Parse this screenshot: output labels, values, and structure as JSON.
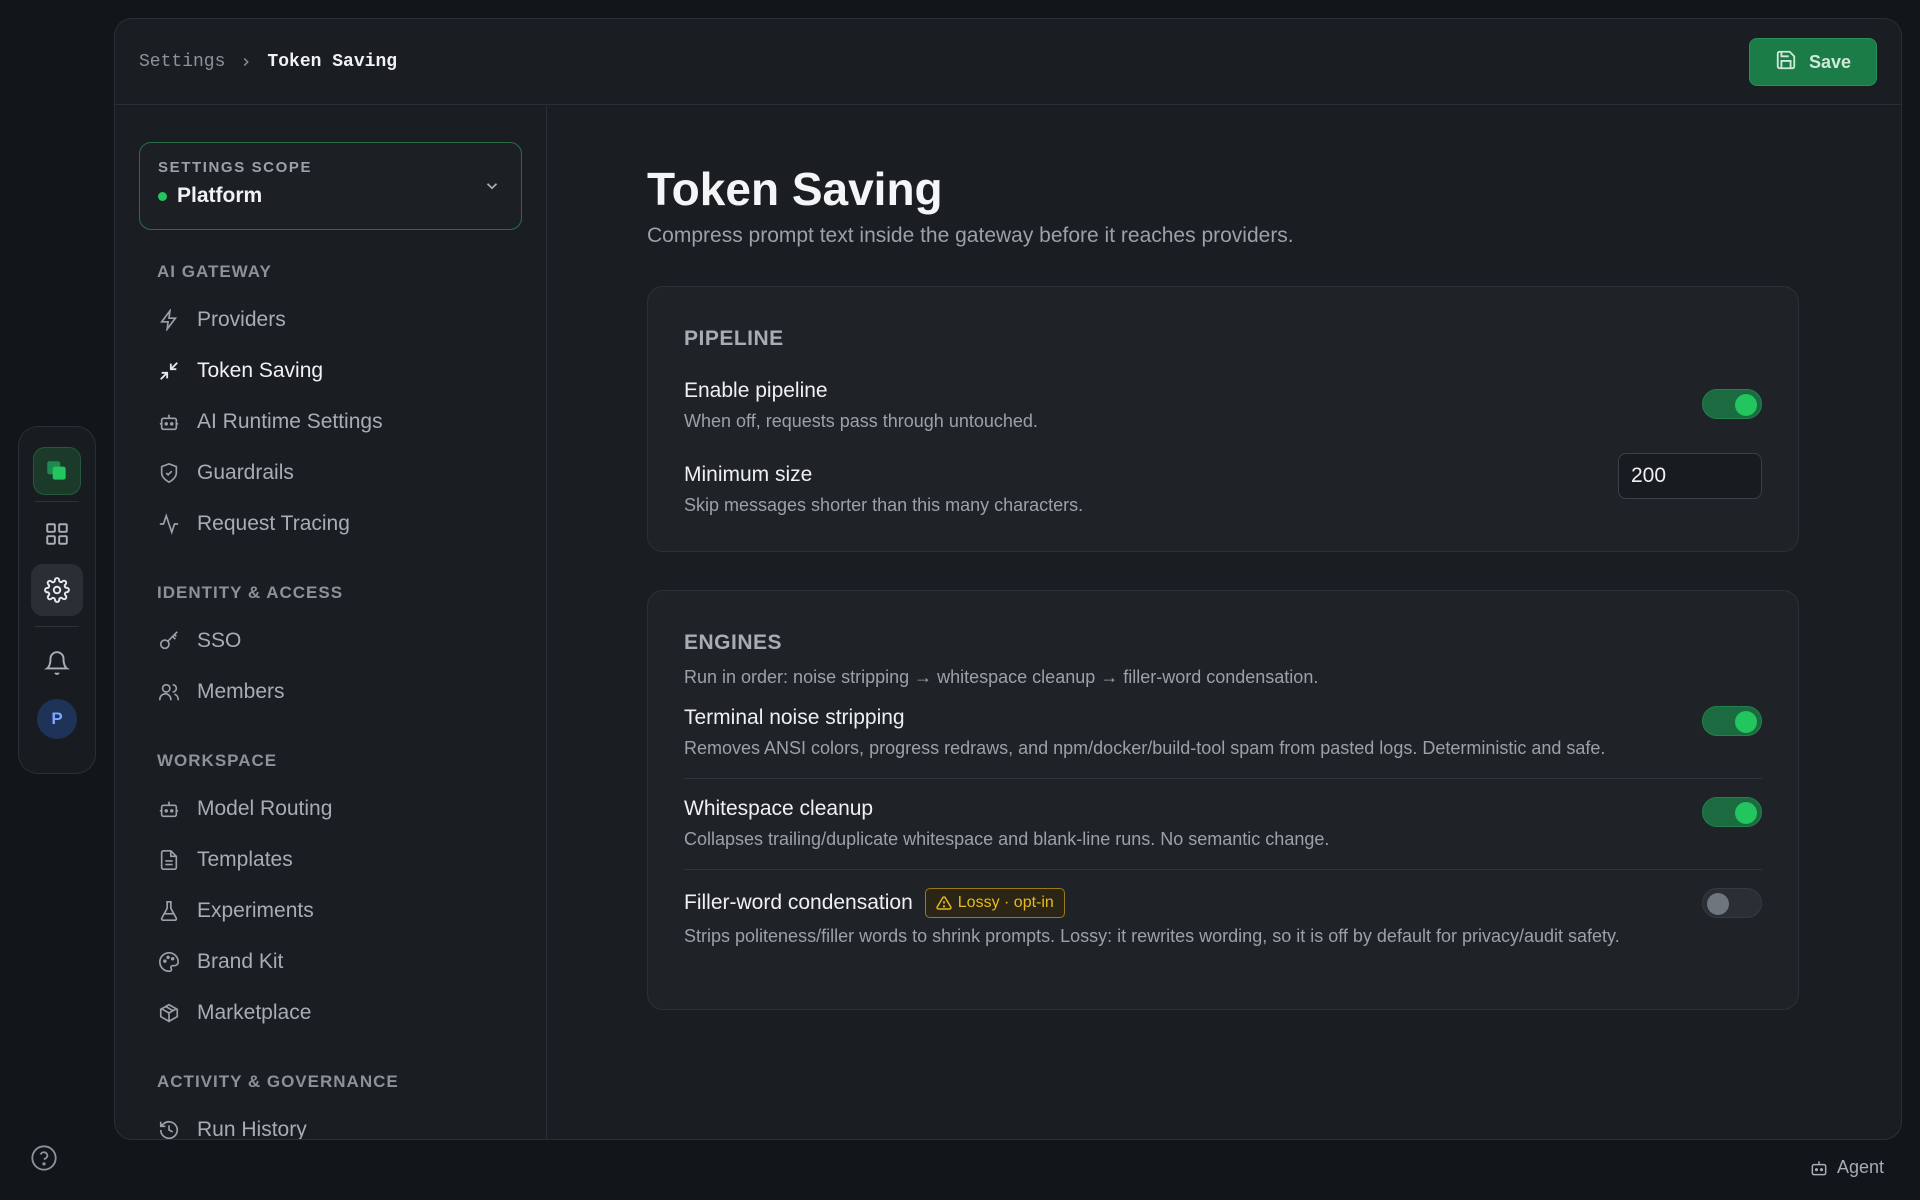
{
  "rail": {
    "user_initial": "P",
    "accent": "#22c55e"
  },
  "breadcrumb": {
    "parent": "Settings",
    "current": "Token Saving"
  },
  "toolbar": {
    "save_label": "Save"
  },
  "scope": {
    "label": "SETTINGS SCOPE",
    "value": "Platform"
  },
  "nav": {
    "ai_gateway": {
      "heading": "AI GATEWAY",
      "items": [
        {
          "label": "Providers",
          "icon": "bolt-icon"
        },
        {
          "label": "Token Saving",
          "icon": "compress-icon",
          "active": true
        },
        {
          "label": "AI Runtime Settings",
          "icon": "bot-icon"
        },
        {
          "label": "Guardrails",
          "icon": "shield-check-icon"
        },
        {
          "label": "Request Tracing",
          "icon": "activity-icon"
        }
      ]
    },
    "identity": {
      "heading": "IDENTITY & ACCESS",
      "items": [
        {
          "label": "SSO",
          "icon": "key-icon"
        },
        {
          "label": "Members",
          "icon": "users-icon"
        }
      ]
    },
    "workspace": {
      "heading": "WORKSPACE",
      "items": [
        {
          "label": "Model Routing",
          "icon": "bot-icon"
        },
        {
          "label": "Templates",
          "icon": "file-text-icon"
        },
        {
          "label": "Experiments",
          "icon": "flask-icon"
        },
        {
          "label": "Brand Kit",
          "icon": "palette-icon"
        },
        {
          "label": "Marketplace",
          "icon": "package-icon"
        }
      ]
    },
    "activity": {
      "heading": "ACTIVITY & GOVERNANCE",
      "items": [
        {
          "label": "Run History",
          "icon": "history-icon"
        }
      ]
    }
  },
  "page": {
    "title": "Token Saving",
    "subtitle": "Compress prompt text inside the gateway before it reaches providers."
  },
  "pipeline": {
    "title": "PIPELINE",
    "enable": {
      "label": "Enable pipeline",
      "description": "When off, requests pass through untouched.",
      "enabled": true
    },
    "min_size": {
      "label": "Minimum size",
      "description": "Skip messages shorter than this many characters.",
      "value": "200"
    }
  },
  "engines": {
    "title": "ENGINES",
    "description": "Run in order: noise stripping → whitespace cleanup → filler-word condensation.",
    "items": [
      {
        "label": "Terminal noise stripping",
        "description": "Removes ANSI colors, progress redraws, and npm/docker/build-tool spam from pasted logs. Deterministic and safe.",
        "enabled": true
      },
      {
        "label": "Whitespace cleanup",
        "description": "Collapses trailing/duplicate whitespace and blank-line runs. No semantic change.",
        "enabled": true
      },
      {
        "label": "Filler-word condensation",
        "badge": "Lossy · opt-in",
        "description": "Strips politeness/filler words to shrink prompts. Lossy: it rewrites wording, so it is off by default for privacy/audit safety.",
        "enabled": false
      }
    ]
  },
  "footer": {
    "agent_label": "Agent"
  }
}
